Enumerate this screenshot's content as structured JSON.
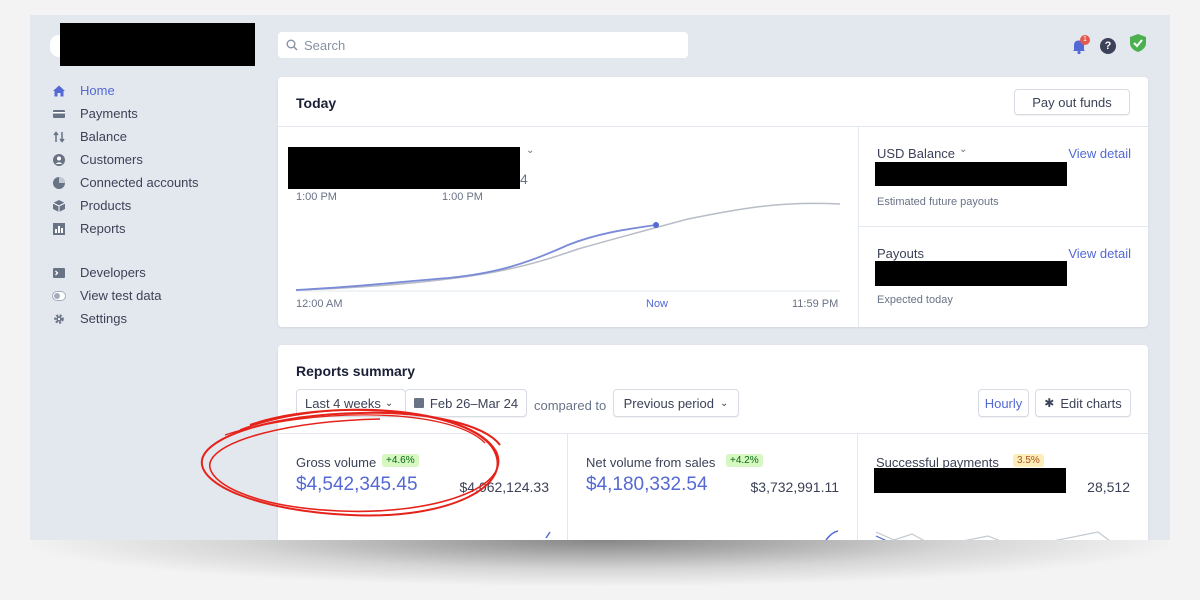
{
  "sidebar": {
    "items": [
      {
        "label": "Home",
        "icon": "home-icon"
      },
      {
        "label": "Payments",
        "icon": "payments-icon"
      },
      {
        "label": "Balance",
        "icon": "balance-icon"
      },
      {
        "label": "Customers",
        "icon": "customers-icon"
      },
      {
        "label": "Connected accounts",
        "icon": "connected-accounts-icon"
      },
      {
        "label": "Products",
        "icon": "products-icon"
      },
      {
        "label": "Reports",
        "icon": "reports-icon"
      }
    ],
    "secondary": [
      {
        "label": "Developers",
        "icon": "terminal-icon"
      },
      {
        "label": "View test data",
        "icon": "toggle-icon"
      },
      {
        "label": "Settings",
        "icon": "gear-icon"
      }
    ]
  },
  "search": {
    "placeholder": "Search"
  },
  "notifications": {
    "count": "1"
  },
  "today": {
    "title": "Today",
    "payout_button": "Pay out funds",
    "time_labels": [
      "1:00 PM",
      "1:00 PM"
    ],
    "axis_labels": {
      "start": "12:00 AM",
      "now": "Now",
      "end": "11:59 PM"
    },
    "partial_digit": "4",
    "usd_balance": {
      "label": "USD Balance",
      "link": "View detail",
      "caption": "Estimated future payouts"
    },
    "payouts": {
      "label": "Payouts",
      "link": "View detail",
      "caption": "Expected today"
    }
  },
  "summary": {
    "title": "Reports summary",
    "range_button": "Last 4 weeks",
    "date_range": "Feb 26–Mar 24",
    "compared_to": "compared to",
    "comparison_button": "Previous period",
    "hourly_button": "Hourly",
    "edit_charts_button": "Edit charts",
    "metrics": [
      {
        "label": "Gross volume",
        "badge": "+4.6%",
        "value": "$4,542,345.45",
        "previous": "$4,062,124.33"
      },
      {
        "label": "Net volume from sales",
        "badge": "+4.2%",
        "value": "$4,180,332.54",
        "previous": "$3,732,991.11"
      },
      {
        "label": "Successful payments",
        "badge": "3.5%",
        "value": "",
        "previous": "28,512"
      }
    ]
  },
  "colors": {
    "accent": "#5469d4",
    "positive_badge_bg": "#d7f7c2",
    "positive_badge_text": "#05690d",
    "warn_badge_bg": "#fcedb9",
    "warn_badge_text": "#a9511b",
    "annotation": "#e5231b"
  }
}
